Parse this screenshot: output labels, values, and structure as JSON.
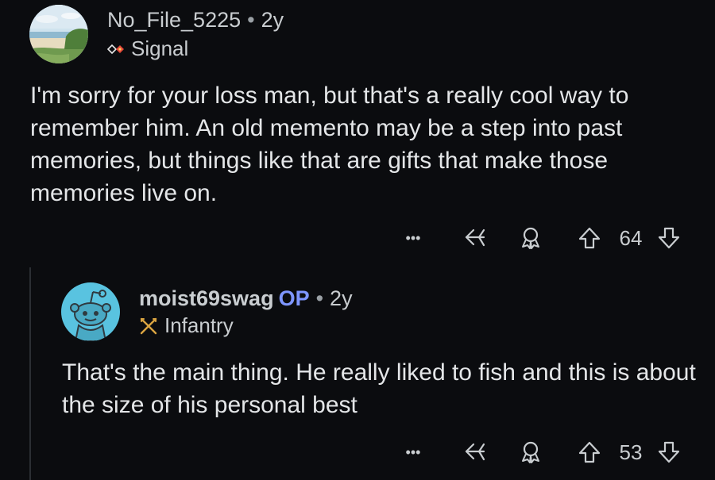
{
  "comments": [
    {
      "username": "No_File_5225",
      "separator": "•",
      "age": "2y",
      "flair": "Signal",
      "body": "I'm sorry for your loss man, but that's a really cool way to remember him. An old memento may be a step into past memories, but things like that are gifts that make those memories live on.",
      "more_icon": "•••",
      "score": "64",
      "icons": [
        "more-icon",
        "reply-icon",
        "award-icon",
        "upvote-icon",
        "downvote-icon"
      ]
    },
    {
      "username": "moist69swag",
      "op_tag": "OP",
      "separator": "•",
      "age": "2y",
      "flair": "Infantry",
      "body": "That's the main thing. He really liked to fish and this is about the size of his personal best",
      "more_icon": "•••",
      "score": "53",
      "icons": [
        "more-icon",
        "reply-icon",
        "award-icon",
        "upvote-icon",
        "downvote-icon"
      ]
    }
  ],
  "colors": {
    "background": "#0b0c0f",
    "op_tag": "#7e96ff",
    "avatar_snoo": "#59c3e0",
    "thread_line": "#2b2e33"
  }
}
